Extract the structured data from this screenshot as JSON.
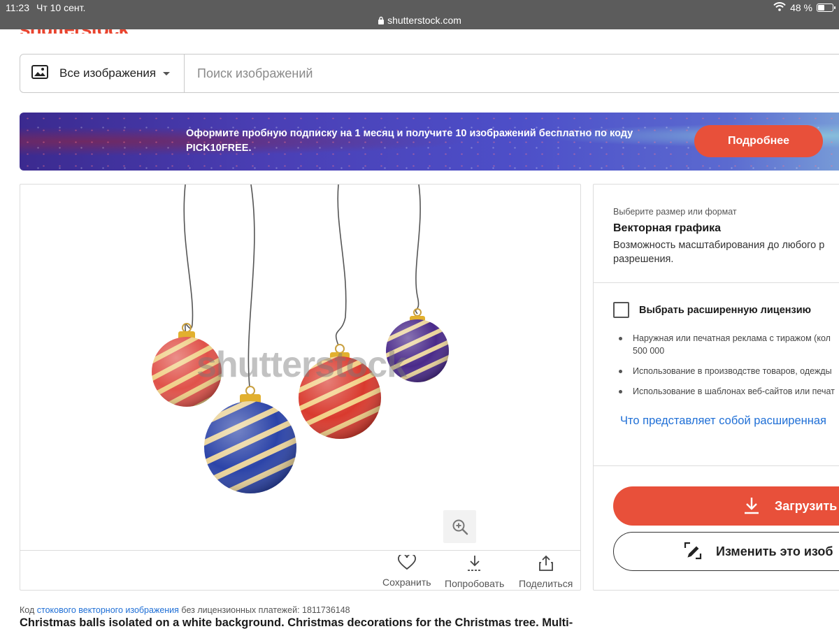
{
  "status_bar": {
    "time": "11:23",
    "date": "Чт 10 сент.",
    "url": "shutterstock.com",
    "battery_percent": "48 %",
    "battery_level": 0.48
  },
  "header": {
    "logo_text": "shutterstock"
  },
  "search": {
    "type_label": "Все изображения",
    "placeholder": "Поиск изображений",
    "value": ""
  },
  "promo": {
    "text": "Оформите пробную подписку на 1 месяц и получите 10 изображений бесплатно по коду PICK10FREE.",
    "button_label": "Подробнее"
  },
  "image": {
    "watermark": "shutterstock",
    "actions": [
      {
        "label": "Сохранить",
        "icon": "heart-icon"
      },
      {
        "label": "Попробовать",
        "icon": "download-try-icon"
      },
      {
        "label": "Поделиться",
        "icon": "share-icon"
      }
    ]
  },
  "license_panel": {
    "size_hint": "Выберите размер или формат",
    "format_title": "Векторная графика",
    "format_desc_line1": "Возможность масштабирования до любого р",
    "format_desc_line2": "разрешения.",
    "extended_license_label": "Выбрать расширенную лицензию",
    "bullets": [
      "Наружная или печатная реклама с тиражом (кол",
      "500 000",
      "Использование в производстве товаров, одежды",
      "Использование в шаблонах веб-сайтов или печат"
    ],
    "info_link": "Что представляет собой расширенная",
    "download_label": "Загрузить",
    "edit_label": "Изменить это изоб"
  },
  "details": {
    "code_prefix": "Код",
    "code_link": "стокового векторного изображения",
    "code_suffix": "без лицензионных платежей: 1811736148",
    "title": "Christmas balls isolated on a white background. Christmas decorations for the Christmas tree. Multi-"
  },
  "colors": {
    "accent": "#e8503a",
    "link": "#1f6fd6"
  }
}
